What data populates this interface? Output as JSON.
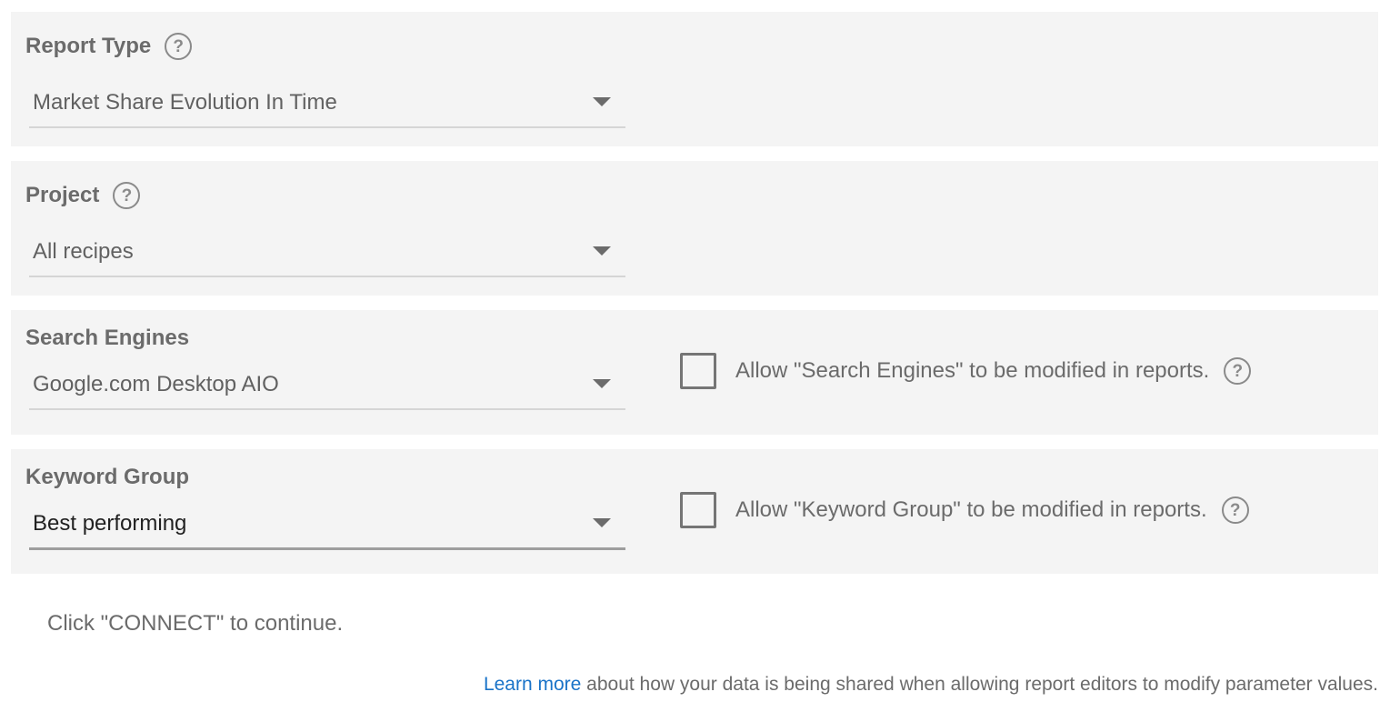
{
  "report_type": {
    "label": "Report Type",
    "help_icon": "help-circle-icon",
    "value": "Market Share Evolution In Time"
  },
  "project": {
    "label": "Project",
    "help_icon": "help-circle-icon",
    "value": "All recipes"
  },
  "search_engines": {
    "label": "Search Engines",
    "value": "Google.com Desktop AIO",
    "allow_label": "Allow \"Search Engines\" to be modified in reports.",
    "allow_checked": false
  },
  "keyword_group": {
    "label": "Keyword Group",
    "value": "Best performing",
    "allow_label": "Allow \"Keyword Group\" to be modified in reports.",
    "allow_checked": false
  },
  "connect_message": "Click \"CONNECT\" to continue.",
  "footer": {
    "link_text": "Learn more",
    "text": "about how your data is being shared when allowing report editors to modify parameter values."
  },
  "colors": {
    "panel_bg": "#f4f4f4",
    "link": "#1a73c8",
    "text": "#616161"
  }
}
